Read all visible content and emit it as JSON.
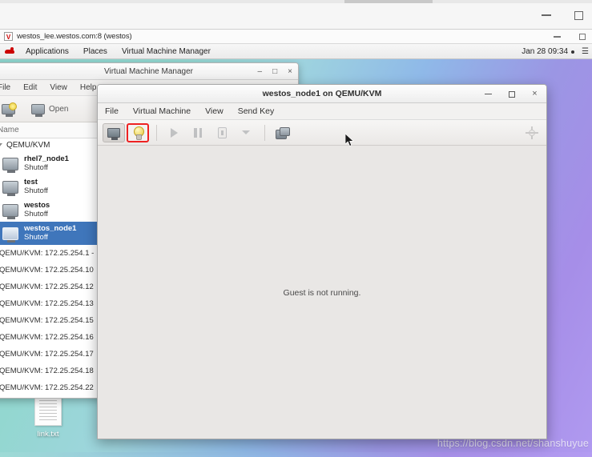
{
  "outer_window": {
    "minimize_label": "–",
    "maximize_label": "☐"
  },
  "vnc_window": {
    "icon": "vnc-icon",
    "title": "westos_lee.westos.com:8 (westos)",
    "minimize_label": "–",
    "maximize_label": "☐"
  },
  "gnome_panel": {
    "logo": "redhat-logo",
    "items": [
      {
        "label": "Applications"
      },
      {
        "label": "Places"
      },
      {
        "label": "Virtual Machine Manager"
      }
    ],
    "clock": "Jan 28  09:34",
    "indicator_dot": "●",
    "network_icon": "wifi-icon"
  },
  "desktop": {
    "file_icon": {
      "name": "link.txt",
      "icon": "text-document-icon"
    },
    "watermark": "https://blog.csdn.net/shanshuyue"
  },
  "vmm_window": {
    "title": "Virtual Machine Manager",
    "controls": {
      "minimize": "–",
      "maximize": "□",
      "close": "×"
    },
    "menus": [
      {
        "label": "File"
      },
      {
        "label": "Edit"
      },
      {
        "label": "View"
      },
      {
        "label": "Help"
      }
    ],
    "toolbar": {
      "new_vm_label": "",
      "open_label": "Open"
    },
    "column_header": "Name",
    "connection_group": "QEMU/KVM",
    "vms": [
      {
        "name": "rhel7_node1",
        "state": "Shutoff",
        "selected": false
      },
      {
        "name": "test",
        "state": "Shutoff",
        "selected": false
      },
      {
        "name": "westos",
        "state": "Shutoff",
        "selected": false
      },
      {
        "name": "westos_node1",
        "state": "Shutoff",
        "selected": true
      }
    ],
    "connections": [
      {
        "label": "QEMU/KVM: 172.25.254.1 - "
      },
      {
        "label": "QEMU/KVM: 172.25.254.10 "
      },
      {
        "label": "QEMU/KVM: 172.25.254.12 "
      },
      {
        "label": "QEMU/KVM: 172.25.254.13 "
      },
      {
        "label": "QEMU/KVM: 172.25.254.15 "
      },
      {
        "label": "QEMU/KVM: 172.25.254.16 "
      },
      {
        "label": "QEMU/KVM: 172.25.254.17 "
      },
      {
        "label": "QEMU/KVM: 172.25.254.18 "
      },
      {
        "label": "QEMU/KVM: 172.25.254.22 "
      }
    ]
  },
  "vm_window": {
    "title": "westos_node1 on QEMU/KVM",
    "controls": {
      "minimize": "–",
      "maximize": "□",
      "close": "×"
    },
    "menus": [
      {
        "label": "File"
      },
      {
        "label": "Virtual Machine"
      },
      {
        "label": "View"
      },
      {
        "label": "Send Key"
      }
    ],
    "toolbar": [
      {
        "name": "show-console-button",
        "icon": "monitor-icon",
        "state": "active"
      },
      {
        "name": "show-details-button",
        "icon": "lightbulb-icon",
        "state": "highlighted"
      },
      {
        "name": "run-button",
        "icon": "play-icon",
        "state": "disabled"
      },
      {
        "name": "pause-button",
        "icon": "pause-icon",
        "state": "disabled"
      },
      {
        "name": "shutdown-button",
        "icon": "power-icon",
        "state": "disabled"
      },
      {
        "name": "shutdown-menu-button",
        "icon": "chevron-down-icon",
        "state": "disabled"
      },
      {
        "name": "snapshots-button",
        "icon": "snapshot-icon",
        "state": "enabled"
      },
      {
        "name": "fullscreen-button",
        "icon": "resize-icon",
        "state": "enabled"
      }
    ],
    "viewport_message": "Guest is not running."
  },
  "colors": {
    "selection_blue": "#3f76bb",
    "highlight_red": "#ee2222",
    "desktop_teal": "#8fd6cf",
    "desktop_purple": "#b09af0",
    "panel_bg": "#f2f1f0"
  }
}
